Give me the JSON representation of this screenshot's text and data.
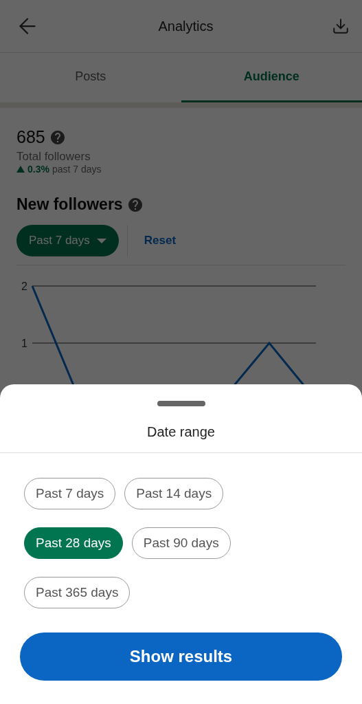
{
  "header": {
    "title": "Analytics"
  },
  "tabs": [
    {
      "label": "Posts",
      "selected": false
    },
    {
      "label": "Audience",
      "selected": true
    }
  ],
  "summary": {
    "value": "685",
    "label": "Total followers",
    "change": "0.3%",
    "change_period": "past 7 days"
  },
  "new_followers": {
    "title": "New followers",
    "filter": "Past 7 days",
    "reset": "Reset",
    "chart": {
      "y_labels": [
        "2",
        "1"
      ]
    }
  },
  "sheet": {
    "title": "Date range",
    "options": [
      {
        "label": "Past 7 days",
        "selected": false
      },
      {
        "label": "Past 14 days",
        "selected": false
      },
      {
        "label": "Past 28 days",
        "selected": true
      },
      {
        "label": "Past 90 days",
        "selected": false
      },
      {
        "label": "Past 365 days",
        "selected": false
      }
    ],
    "button": "Show results"
  }
}
